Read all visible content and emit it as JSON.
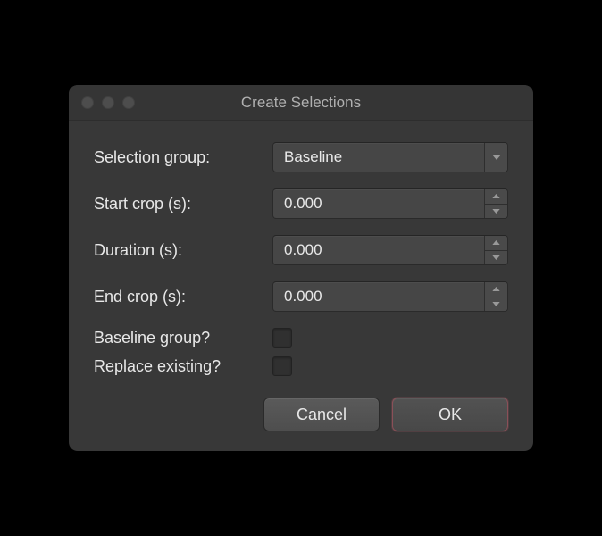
{
  "window": {
    "title": "Create Selections"
  },
  "form": {
    "selection_group": {
      "label": "Selection group:",
      "value": "Baseline"
    },
    "start_crop": {
      "label": "Start crop (s):",
      "value": "0.000"
    },
    "duration": {
      "label": "Duration (s):",
      "value": "0.000"
    },
    "end_crop": {
      "label": "End crop (s):",
      "value": "0.000"
    },
    "baseline_group": {
      "label": "Baseline group?",
      "checked": false
    },
    "replace_existing": {
      "label": "Replace existing?",
      "checked": false
    }
  },
  "buttons": {
    "cancel": "Cancel",
    "ok": "OK"
  }
}
